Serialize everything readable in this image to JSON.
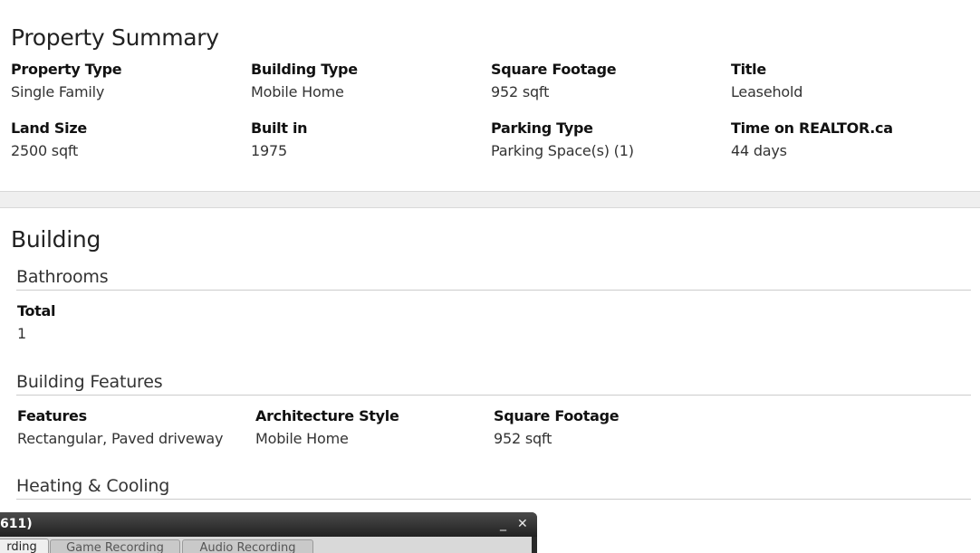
{
  "summary": {
    "title": "Property Summary",
    "fields": [
      {
        "label": "Property Type",
        "value": "Single Family"
      },
      {
        "label": "Building Type",
        "value": "Mobile Home"
      },
      {
        "label": "Square Footage",
        "value": "952 sqft"
      },
      {
        "label": "Title",
        "value": "Leasehold"
      },
      {
        "label": "Land Size",
        "value": "2500 sqft"
      },
      {
        "label": "Built in",
        "value": "1975"
      },
      {
        "label": "Parking Type",
        "value": "Parking Space(s) (1)"
      },
      {
        "label": "Time on REALTOR.ca",
        "value": "44 days"
      }
    ]
  },
  "building": {
    "title": "Building",
    "bathrooms": {
      "title": "Bathrooms",
      "fields": [
        {
          "label": "Total",
          "value": "1"
        }
      ]
    },
    "features": {
      "title": "Building Features",
      "fields": [
        {
          "label": "Features",
          "value": "Rectangular, Paved driveway"
        },
        {
          "label": "Architecture Style",
          "value": "Mobile Home"
        },
        {
          "label": "Square Footage",
          "value": "952 sqft"
        }
      ]
    },
    "heating": {
      "title": "Heating & Cooling"
    }
  },
  "overlay": {
    "title": "611)",
    "minimize_symbol": "_",
    "close_symbol": "✕",
    "tabs": [
      {
        "label": "rding",
        "active": true
      },
      {
        "label": "Game Recording",
        "active": false
      },
      {
        "label": "Audio Recording",
        "active": false
      }
    ]
  }
}
